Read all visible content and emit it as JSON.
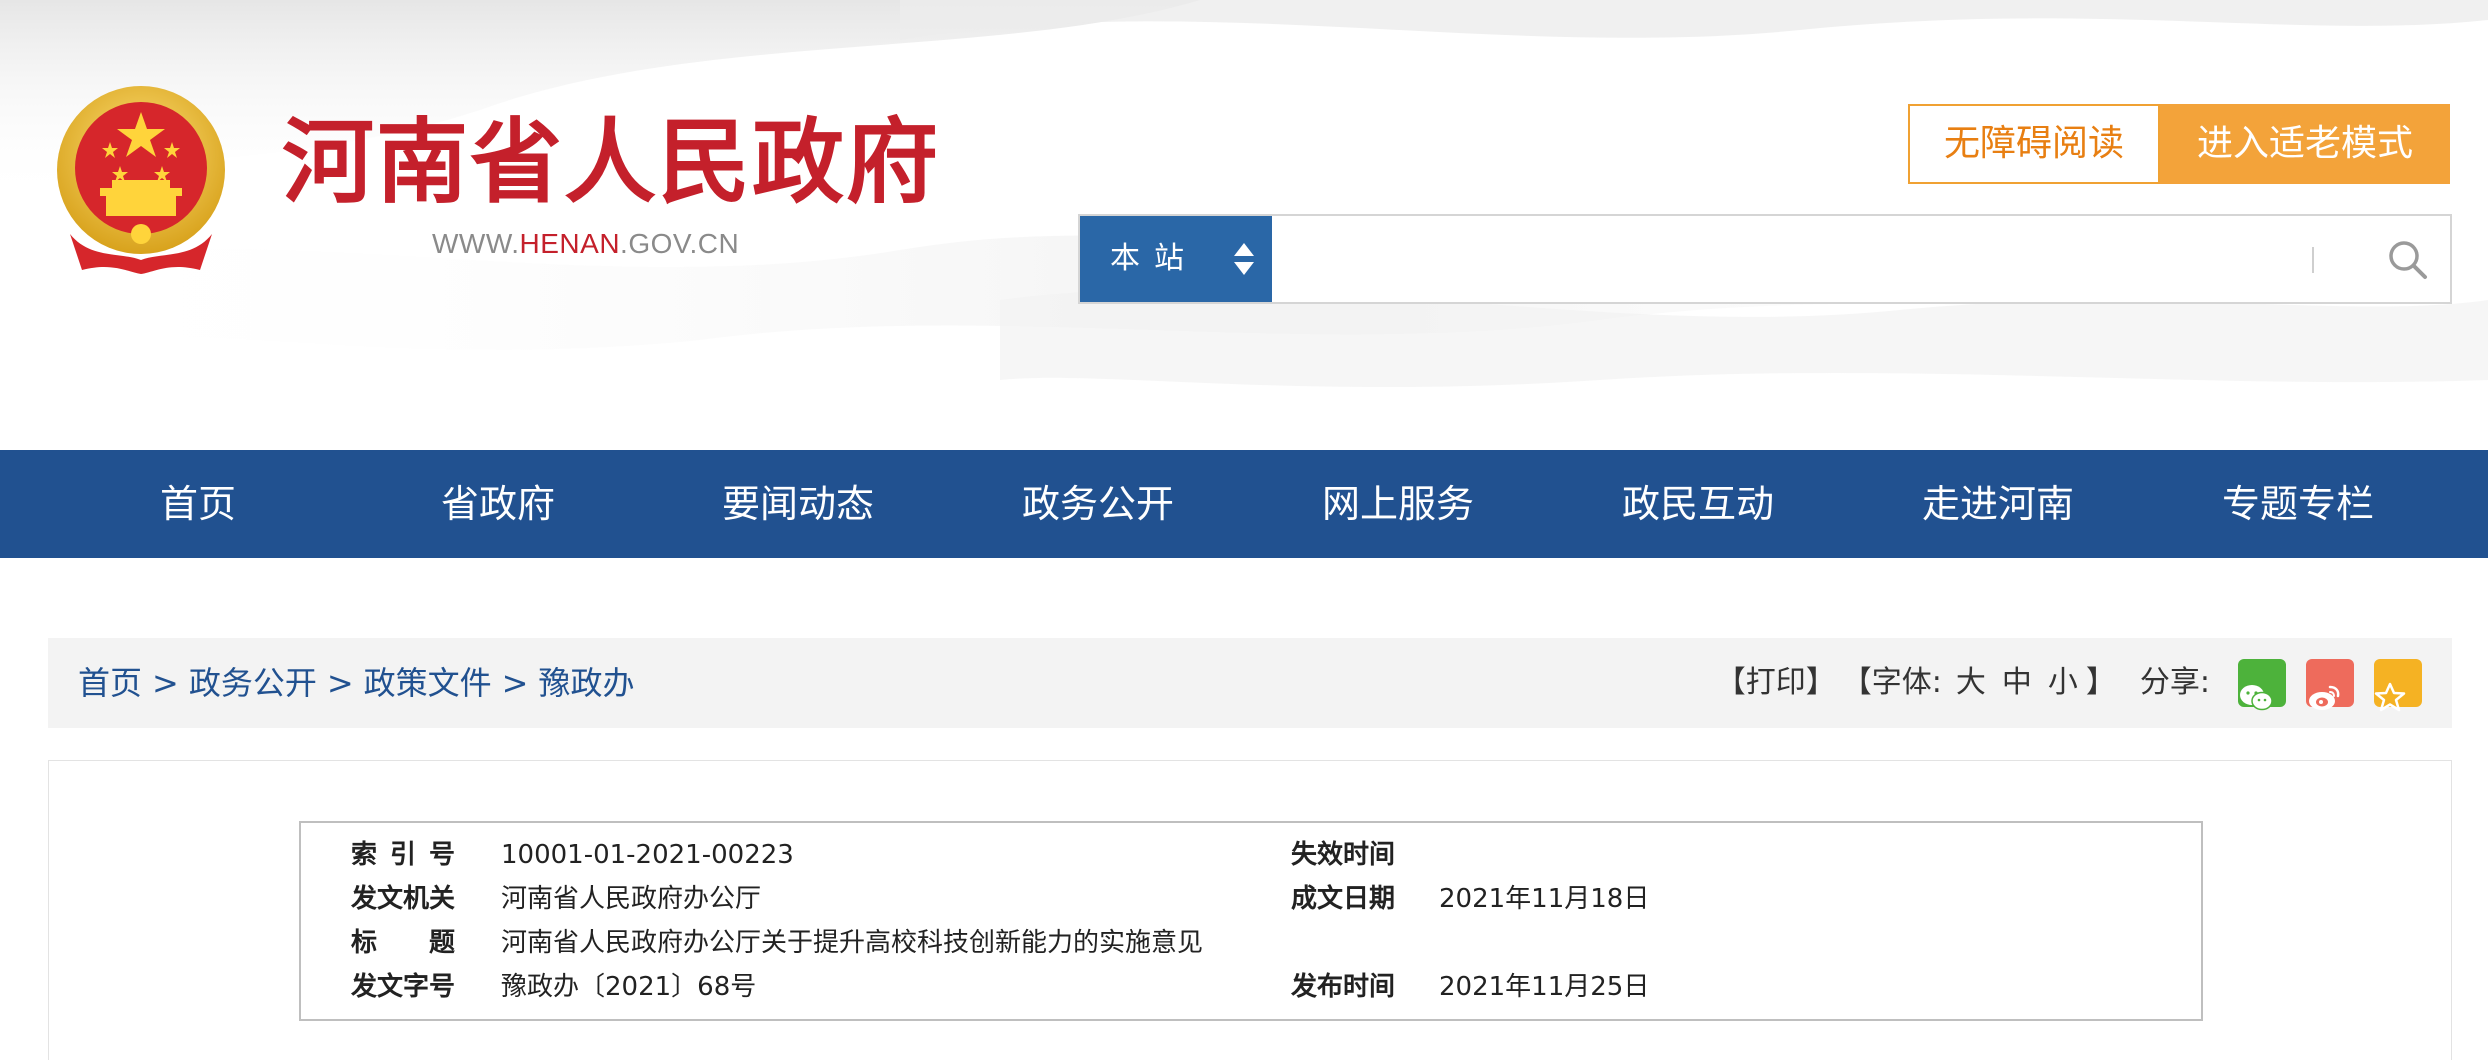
{
  "header": {
    "site_title": "河南省人民政府",
    "site_url_prefix": "WWW.",
    "site_url_highlight": "HENAN",
    "site_url_suffix": ".GOV.CN",
    "accessibility_button": "无障碍阅读",
    "elder_mode_button": "进入适老模式",
    "colors": {
      "title_red": "#c4202b",
      "accent_orange": "#f3a33a",
      "brand_blue": "#215190"
    }
  },
  "search": {
    "scope_label": "本站",
    "input_value": "",
    "placeholder": "",
    "search_icon": "search-icon",
    "scope_icon": "up-down-arrows-icon"
  },
  "nav": {
    "items": [
      {
        "label": "首页"
      },
      {
        "label": "省政府"
      },
      {
        "label": "要闻动态"
      },
      {
        "label": "政务公开"
      },
      {
        "label": "网上服务"
      },
      {
        "label": "政民互动"
      },
      {
        "label": "走进河南"
      },
      {
        "label": "专题专栏"
      }
    ]
  },
  "breadcrumb": {
    "items": [
      "首页",
      "政务公开",
      "政策文件",
      "豫政办"
    ],
    "separator": ">"
  },
  "tools": {
    "print": "【打印】",
    "font_open": "【字体:",
    "font_large": "大",
    "font_medium": "中",
    "font_small": "小",
    "font_close": "】",
    "share_label": "分享:",
    "share_icons": [
      "wechat-icon",
      "weibo-icon",
      "favorite-star-icon"
    ]
  },
  "document_info": {
    "index_label": "索引号",
    "index_value": "10001-01-2021-00223",
    "expiry_label": "失效时间",
    "expiry_value": "",
    "issuer_label": "发文机关",
    "issuer_value": "河南省人民政府办公厅",
    "created_label": "成文日期",
    "created_value": "2021年11月18日",
    "title_label": "标题",
    "title_value": "河南省人民政府办公厅关于提升高校科技创新能力的实施意见",
    "doc_number_label": "发文字号",
    "doc_number_value": "豫政办〔2021〕68号",
    "published_label": "发布时间",
    "published_value": "2021年11月25日"
  }
}
